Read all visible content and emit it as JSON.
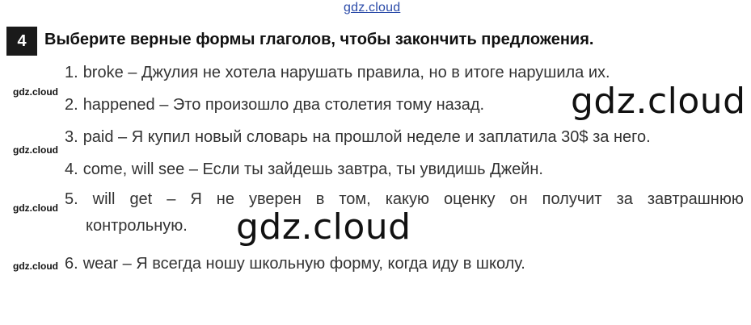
{
  "watermark_top": "gdz.cloud",
  "watermark_side": "gdz.cloud",
  "watermark_big": "gdz.cloud",
  "task": {
    "number": "4",
    "title": "Выберите верные формы глаголов, чтобы закончить предложения."
  },
  "items": [
    {
      "num": "1.",
      "text": "broke – Джулия не хотела нарушать правила, но в итоге нарушила их."
    },
    {
      "num": "2.",
      "text": "happened – Это произошло два столетия тому назад."
    },
    {
      "num": "3.",
      "text": "paid – Я купил новый словарь на прошлой неделе и заплатила 30$ за него."
    },
    {
      "num": "4.",
      "text": "come, will see – Если ты зайдешь завтра, ты увидишь Джейн."
    },
    {
      "num": "5.",
      "words": [
        "will",
        "get",
        "–",
        "Я",
        "не",
        "уверен",
        "в",
        "том,",
        "какую",
        "оценку",
        "он",
        "получит",
        "за",
        "завтрашнюю"
      ],
      "line2": "контрольную."
    },
    {
      "num": "6.",
      "text": "wear – Я всегда ношу школьную форму, когда иду в школу."
    }
  ]
}
